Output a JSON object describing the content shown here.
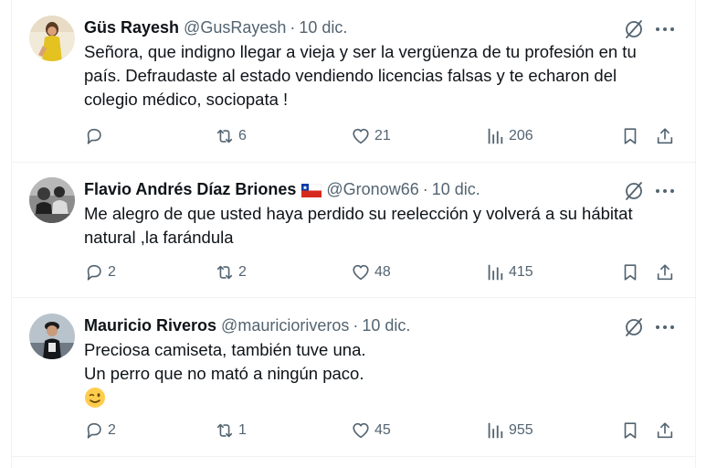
{
  "tweets": [
    {
      "name": "Güs Rayesh",
      "handle": "@GusRayesh",
      "time": "10 dic.",
      "lines": [
        "Señora, que indigno llegar a vieja y ser la vergüenza de tu profesión en tu país. Defraudaste al estado vendiendo licencias falsas y te echaron del colegio médico, sociopata !"
      ],
      "replies": "",
      "reposts": "6",
      "likes": "21",
      "views": "206"
    },
    {
      "name": "Flavio Andrés Díaz Briones",
      "flag": "chile-flag",
      "handle": "@Gronow66",
      "time": "10 dic.",
      "lines": [
        "Me alegro de que usted haya perdido su reelección y volverá a su hábitat natural ,la farándula"
      ],
      "replies": "2",
      "reposts": "2",
      "likes": "48",
      "views": "415"
    },
    {
      "name": "Mauricio Riveros",
      "handle": "@mauricioriveros",
      "time": "10 dic.",
      "lines": [
        "Preciosa camiseta, también tuve una.",
        "Un perro que no mató a ningún paco."
      ],
      "emoji": "winking-face-emoji",
      "replies": "2",
      "reposts": "1",
      "likes": "45",
      "views": "955"
    }
  ],
  "icons": {
    "reply": "reply-icon",
    "repost": "repost-icon",
    "like": "heart-icon",
    "views": "views-icon",
    "bookmark": "bookmark-icon",
    "share": "share-icon",
    "grok": "grok-icon",
    "more": "more-icon"
  },
  "colors": {
    "text": "#0f1419",
    "secondary": "#536471",
    "border": "#eff3f4"
  }
}
